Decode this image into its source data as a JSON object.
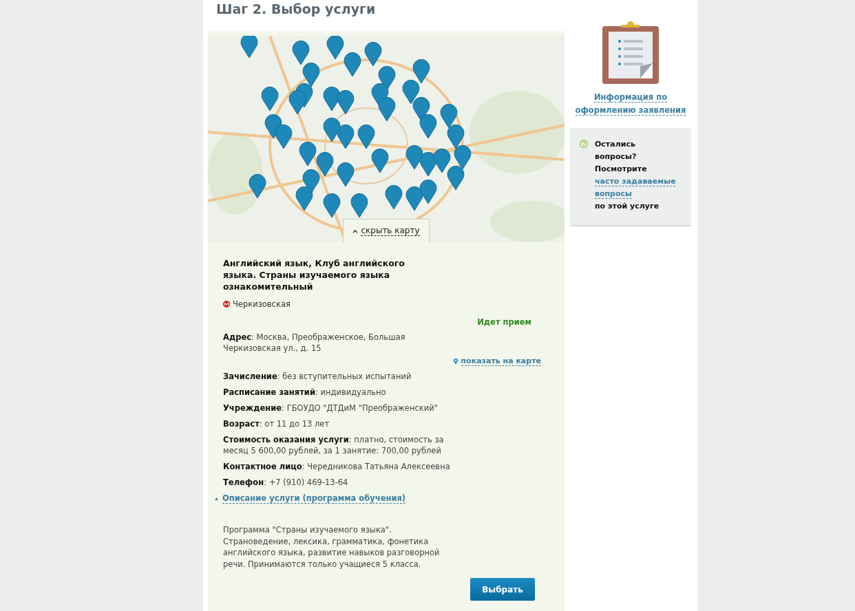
{
  "step_title": "Шаг 2. Выбор услуги",
  "map": {
    "hide_button": "скрыть карту"
  },
  "service": {
    "title": "Английский язык, Клуб английского языка. Страны изучаемого языка ознакомительный",
    "metro": "Черкизовская",
    "status": "Идет прием",
    "show_on_map": "показать на карте",
    "fields": [
      "**Адрес**: Москва, Преображенское, Большая Черкизовская ул., д. 15",
      "**Зачисление**: без вступительных испытаний",
      "**Расписание занятий**: индивидуально",
      "**Учреждение**: ГБОУДО \"ДТДиМ \"Преображенский\"",
      "**Возраст**: от 11 до 13 лет",
      "**Стоимость оказания услуги**: платно, стоимость за месяц 5 600,00 рублей, за 1 занятие: 700,00 рублей",
      "**Контактное лицо**: Чередникова Татьяна Алексеевна",
      "**Телефон**: +7 (910) 469-13-64"
    ],
    "description_toggle": {
      "label": "Описание услуги (программа обучения)",
      "expanded": true
    },
    "description": "Программа \"Страны изучаемого языка\". Страноведение, лексика, грамматика, фонетика английского языка, развитие навыков разговорной речи. Принимаются только учащиеся 5 класса.",
    "select_button": "Выбрать"
  },
  "sidebar": {
    "info_link": "Информация по оформлению заявления",
    "help": {
      "text": "Остались вопросы? Посмотрите",
      "link": "часто задаваемые вопросы",
      "suffix": "по этой услуге"
    }
  }
}
